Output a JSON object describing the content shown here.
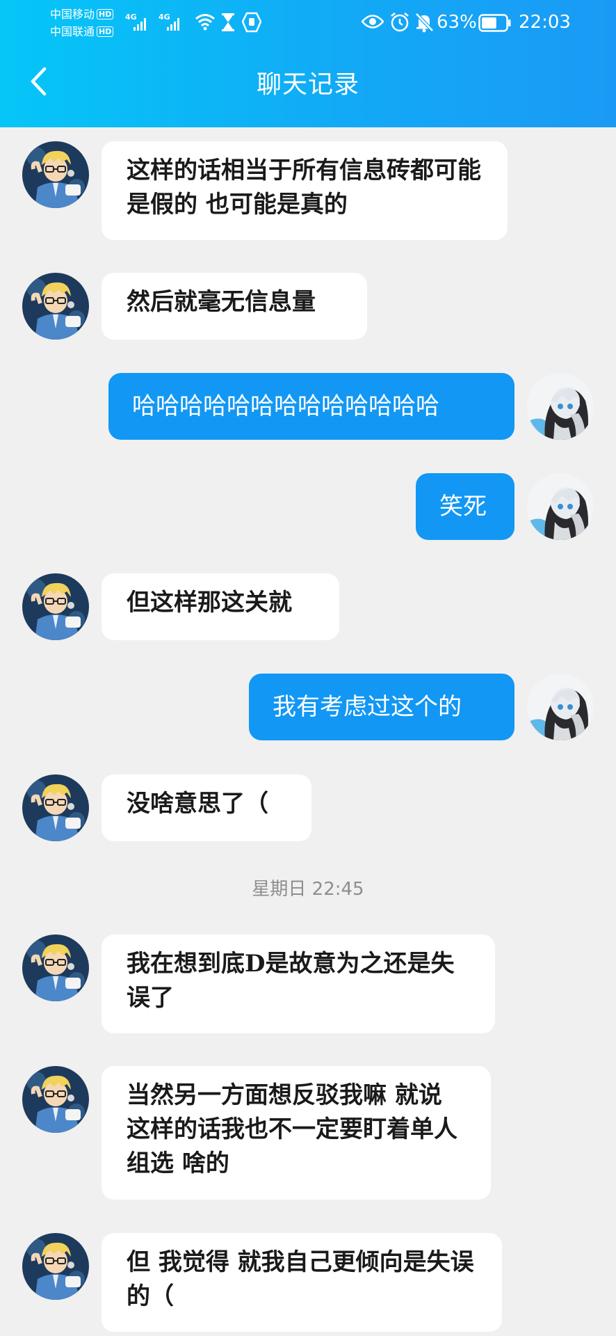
{
  "status_bar": {
    "carrier_1": "中国移动",
    "carrier_2": "中国联通",
    "hd_badge": "HD",
    "network_type": "4G",
    "battery_percent": "63%",
    "battery_level": 0.63,
    "time": "22:03"
  },
  "header": {
    "title": "聊天记录",
    "background_color": "#0dbaf6"
  },
  "messages": [
    {
      "side": "incoming",
      "text": "这样的话相当于所有信息砖都可能是假的 也可能是真的"
    },
    {
      "side": "incoming",
      "text": "然后就毫无信息量"
    },
    {
      "side": "outgoing",
      "text": "哈哈哈哈哈哈哈哈哈哈哈哈哈"
    },
    {
      "side": "outgoing",
      "text": "笑死"
    },
    {
      "side": "incoming",
      "text": "但这样那这关就"
    },
    {
      "side": "outgoing",
      "text": "我有考虑过这个的"
    },
    {
      "side": "incoming",
      "text": "没啥意思了（"
    },
    {
      "side": "incoming",
      "text": "我在想到底D是故意为之还是失误了"
    },
    {
      "side": "incoming",
      "text": "当然另一方面想反驳我嘛 就说 这样的话我也不一定要盯着单人组选 啥的"
    },
    {
      "side": "incoming",
      "text": "但 我觉得 就我自己更倾向是失误的（"
    }
  ],
  "timestamp_divider": "星期日 22:45",
  "colors": {
    "outgoing_bubble": "#1297f4",
    "incoming_bubble": "#ffffff",
    "chat_background": "#f0f0f0"
  }
}
